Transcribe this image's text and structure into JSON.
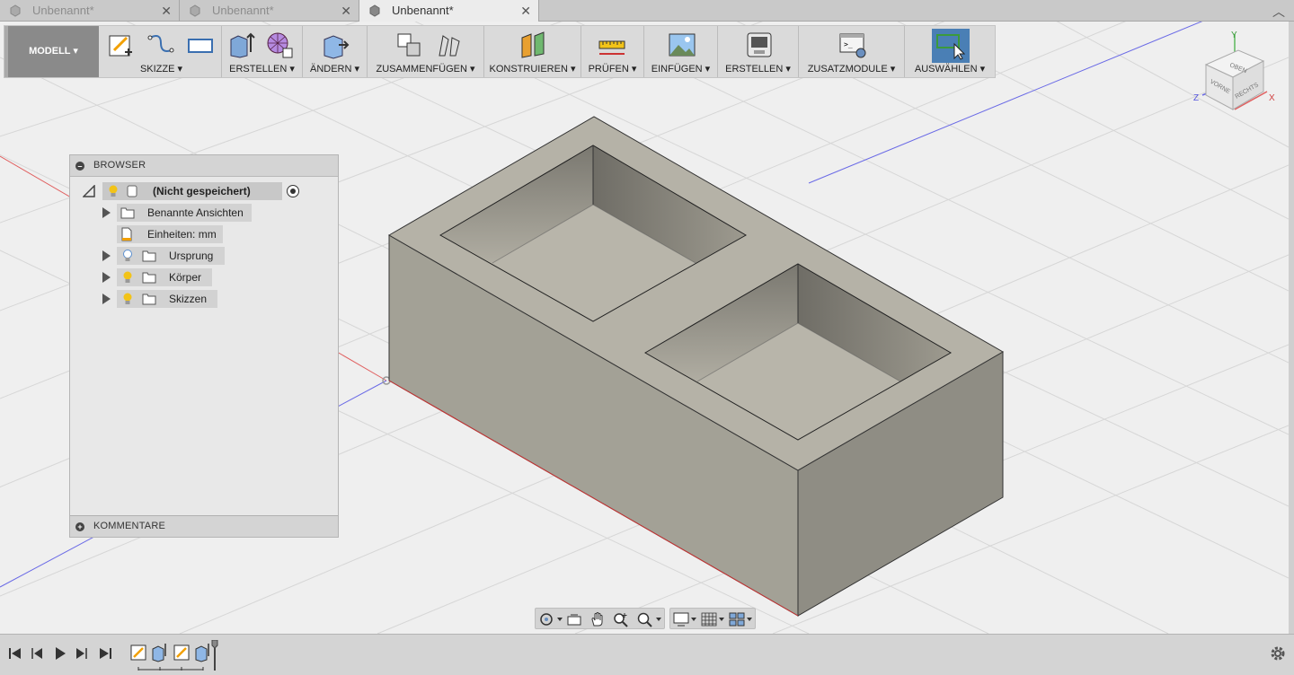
{
  "tabs": [
    {
      "label": "Unbenannt*",
      "active": false
    },
    {
      "label": "Unbenannt*",
      "active": false
    },
    {
      "label": "Unbenannt*",
      "active": true
    }
  ],
  "toolbar": {
    "workspace": "MODELL ▾",
    "groups": [
      {
        "label": "SKIZZE ▾"
      },
      {
        "label": "ERSTELLEN ▾"
      },
      {
        "label": "ÄNDERN ▾"
      },
      {
        "label": "ZUSAMMENFÜGEN ▾"
      },
      {
        "label": "KONSTRUIEREN ▾"
      },
      {
        "label": "PRÜFEN ▾"
      },
      {
        "label": "EINFÜGEN ▾"
      },
      {
        "label": "ERSTELLEN ▾"
      },
      {
        "label": "ZUSATZMODULE ▾"
      },
      {
        "label": "AUSWÄHLEN ▾"
      }
    ]
  },
  "viewcube": {
    "top": "OBEN",
    "front": "VORNE",
    "right": "RECHTS",
    "axis_x": "X",
    "axis_y": "Y",
    "axis_z": "Z"
  },
  "browser": {
    "title": "BROWSER",
    "root": "(Nicht gespeichert)",
    "items": [
      {
        "label": "Benannte Ansichten"
      },
      {
        "label": "Einheiten: mm"
      },
      {
        "label": "Ursprung"
      },
      {
        "label": "Körper"
      },
      {
        "label": "Skizzen"
      }
    ],
    "comments": "KOMMENTARE"
  },
  "colors": {
    "selection": "#4a7fb5",
    "bulb": "#f2c318",
    "axis_red": "#e06060",
    "axis_blue": "#6a6ae6"
  }
}
